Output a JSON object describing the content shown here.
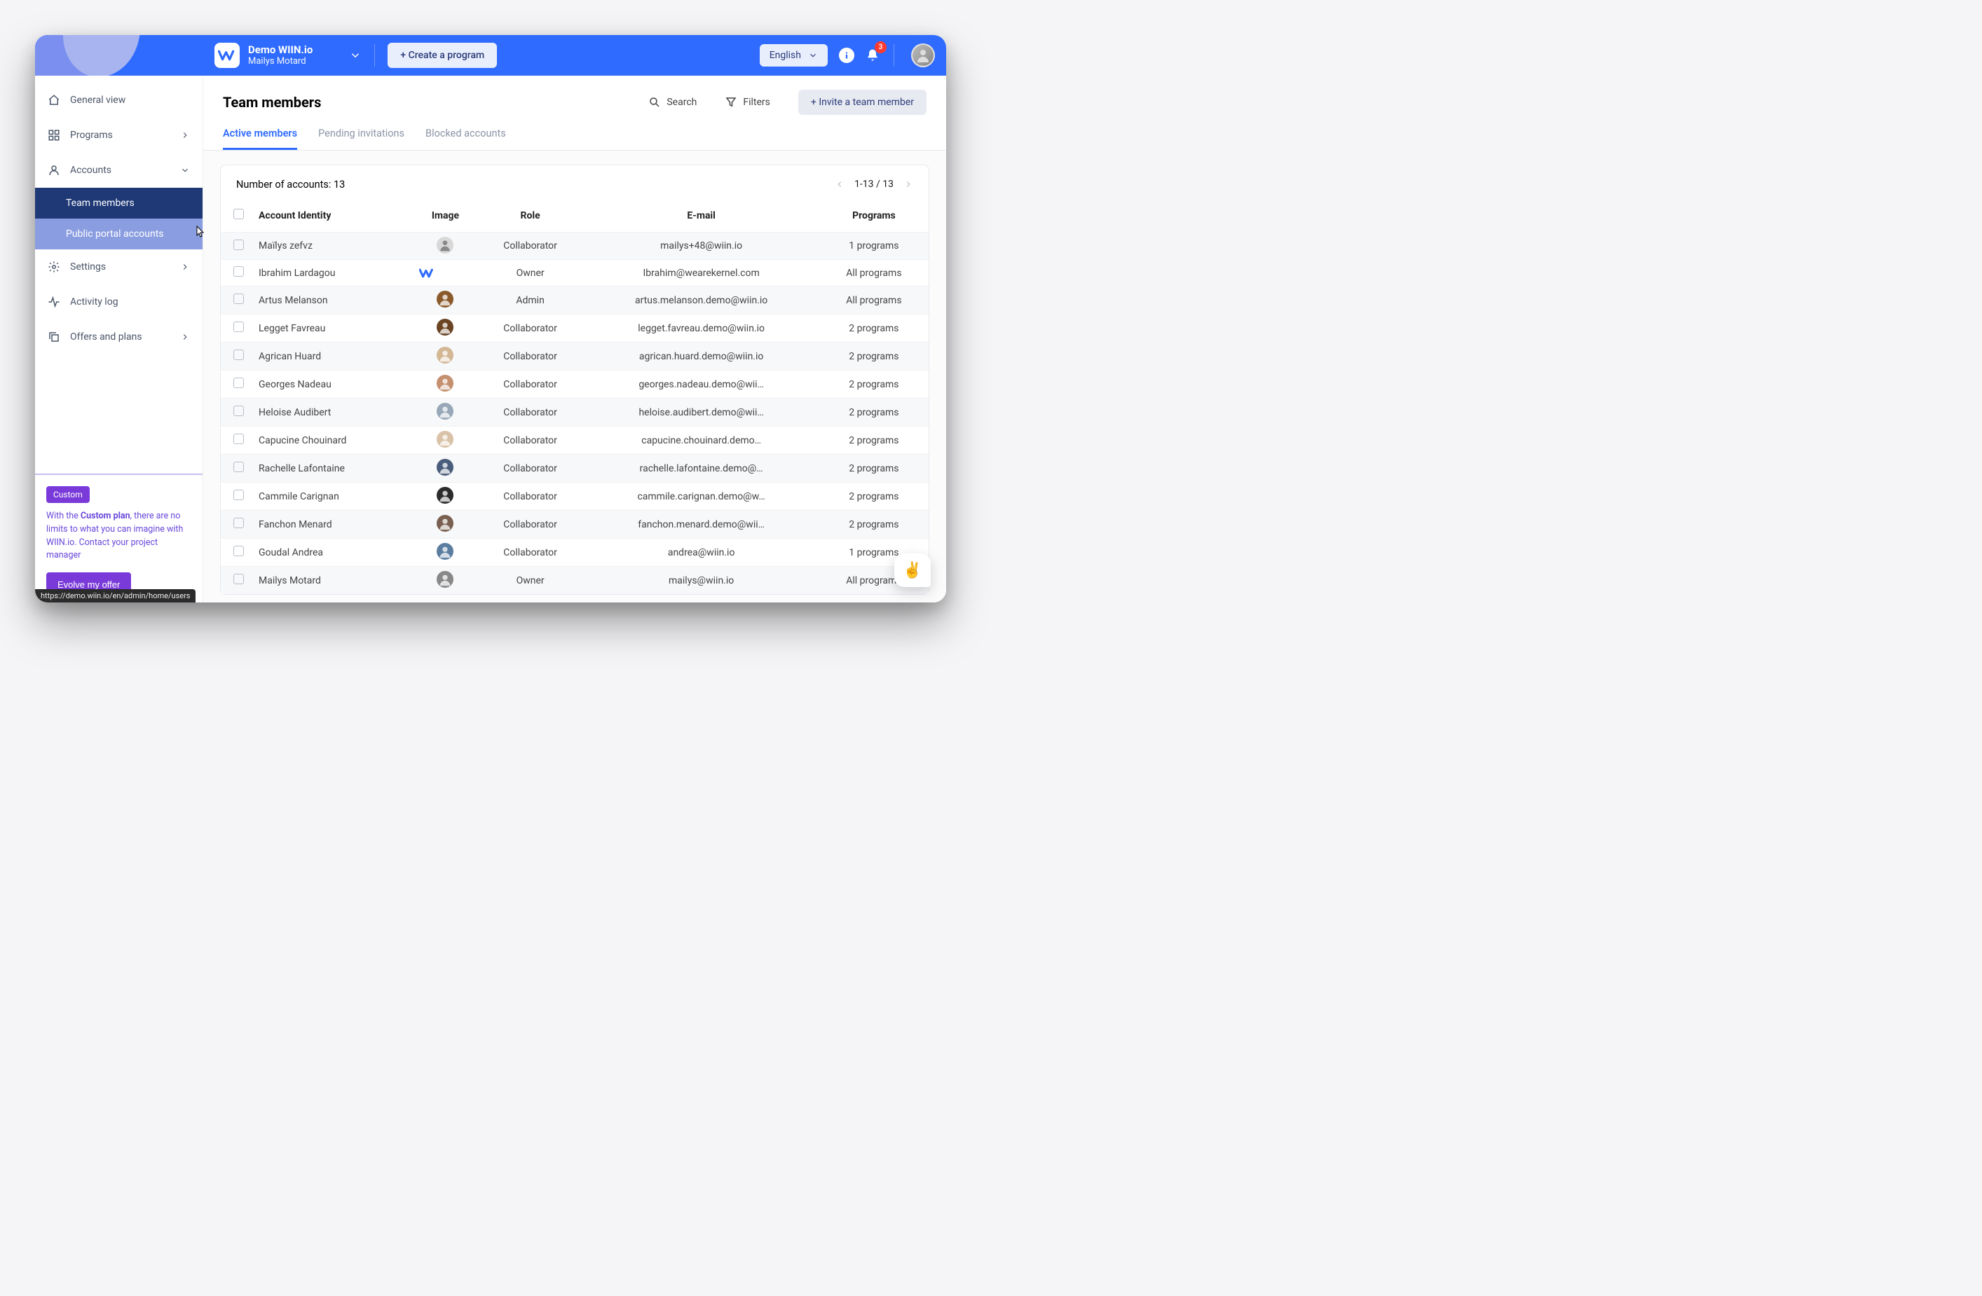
{
  "topbar": {
    "app_title": "Demo WIIN.io",
    "user_name": "Mailys Motard",
    "create_button": "+ Create a program",
    "language": "English",
    "notification_count": "3"
  },
  "sidebar": {
    "items": {
      "general": "General view",
      "programs": "Programs",
      "accounts": "Accounts",
      "team_members": "Team members",
      "public_portal": "Public portal accounts",
      "settings": "Settings",
      "activity": "Activity log",
      "offers": "Offers and plans"
    },
    "promo": {
      "tag": "Custom",
      "text_1": "With the ",
      "text_bold": "Custom plan",
      "text_2": ", there are no limits to what you can imagine with WIIN.io. Contact your project manager",
      "cta": "Evolve my offer"
    },
    "url_tooltip": "https://demo.wiin.io/en/admin/home/users"
  },
  "page": {
    "title": "Team members",
    "search": "Search",
    "filters": "Filters",
    "invite": "+ Invite a team member"
  },
  "tabs": {
    "active": "Active members",
    "pending": "Pending invitations",
    "blocked": "Blocked accounts"
  },
  "table": {
    "count_label": "Number of accounts: 13",
    "pager": "1-13 / 13",
    "headers": {
      "identity": "Account Identity",
      "image": "Image",
      "role": "Role",
      "email": "E-mail",
      "programs": "Programs"
    },
    "rows": [
      {
        "name": "Maïlys zefvz",
        "color": "#cfcfcf",
        "role": "Collaborator",
        "email": "mailys+48@wiin.io",
        "programs": "1 programs",
        "hi": true,
        "type": "silhouette"
      },
      {
        "name": "Ibrahim Lardagou",
        "color": "#2f6bff",
        "role": "Owner",
        "email": "Ibrahim@wearekernel.com",
        "programs": "All programs",
        "type": "wiin"
      },
      {
        "name": "Artus Melanson",
        "color": "#8b5a2b",
        "role": "Admin",
        "email": "artus.melanson.demo@wiin.io",
        "programs": "All programs",
        "hi": true
      },
      {
        "name": "Legget Favreau",
        "color": "#6b4423",
        "role": "Collaborator",
        "email": "legget.favreau.demo@wiin.io",
        "programs": "2 programs"
      },
      {
        "name": "Agrican Huard",
        "color": "#d4b896",
        "role": "Collaborator",
        "email": "agrican.huard.demo@wiin.io",
        "programs": "2 programs",
        "hi": true
      },
      {
        "name": "Georges Nadeau",
        "color": "#c49070",
        "role": "Collaborator",
        "email": "georges.nadeau.demo@wii…",
        "programs": "2 programs"
      },
      {
        "name": "Heloise Audibert",
        "color": "#98a8b8",
        "role": "Collaborator",
        "email": "heloise.audibert.demo@wii…",
        "programs": "2 programs",
        "hi": true
      },
      {
        "name": "Capucine Chouinard",
        "color": "#d9c2a8",
        "role": "Collaborator",
        "email": "capucine.chouinard.demo…",
        "programs": "2 programs"
      },
      {
        "name": "Rachelle Lafontaine",
        "color": "#4a5d7c",
        "role": "Collaborator",
        "email": "rachelle.lafontaine.demo@…",
        "programs": "2 programs",
        "hi": true
      },
      {
        "name": "Cammile Carignan",
        "color": "#2b2b2b",
        "role": "Collaborator",
        "email": "cammile.carignan.demo@w…",
        "programs": "2 programs"
      },
      {
        "name": "Fanchon Menard",
        "color": "#7a6050",
        "role": "Collaborator",
        "email": "fanchon.menard.demo@wii…",
        "programs": "2 programs",
        "hi": true
      },
      {
        "name": "Goudal Andrea",
        "color": "#5a7da0",
        "role": "Collaborator",
        "email": "andrea@wiin.io",
        "programs": "1 programs"
      },
      {
        "name": "Mailys Motard",
        "color": "#888888",
        "role": "Owner",
        "email": "mailys@wiin.io",
        "programs": "All programs",
        "hi": true
      }
    ]
  },
  "chat_emoji": "✌️"
}
